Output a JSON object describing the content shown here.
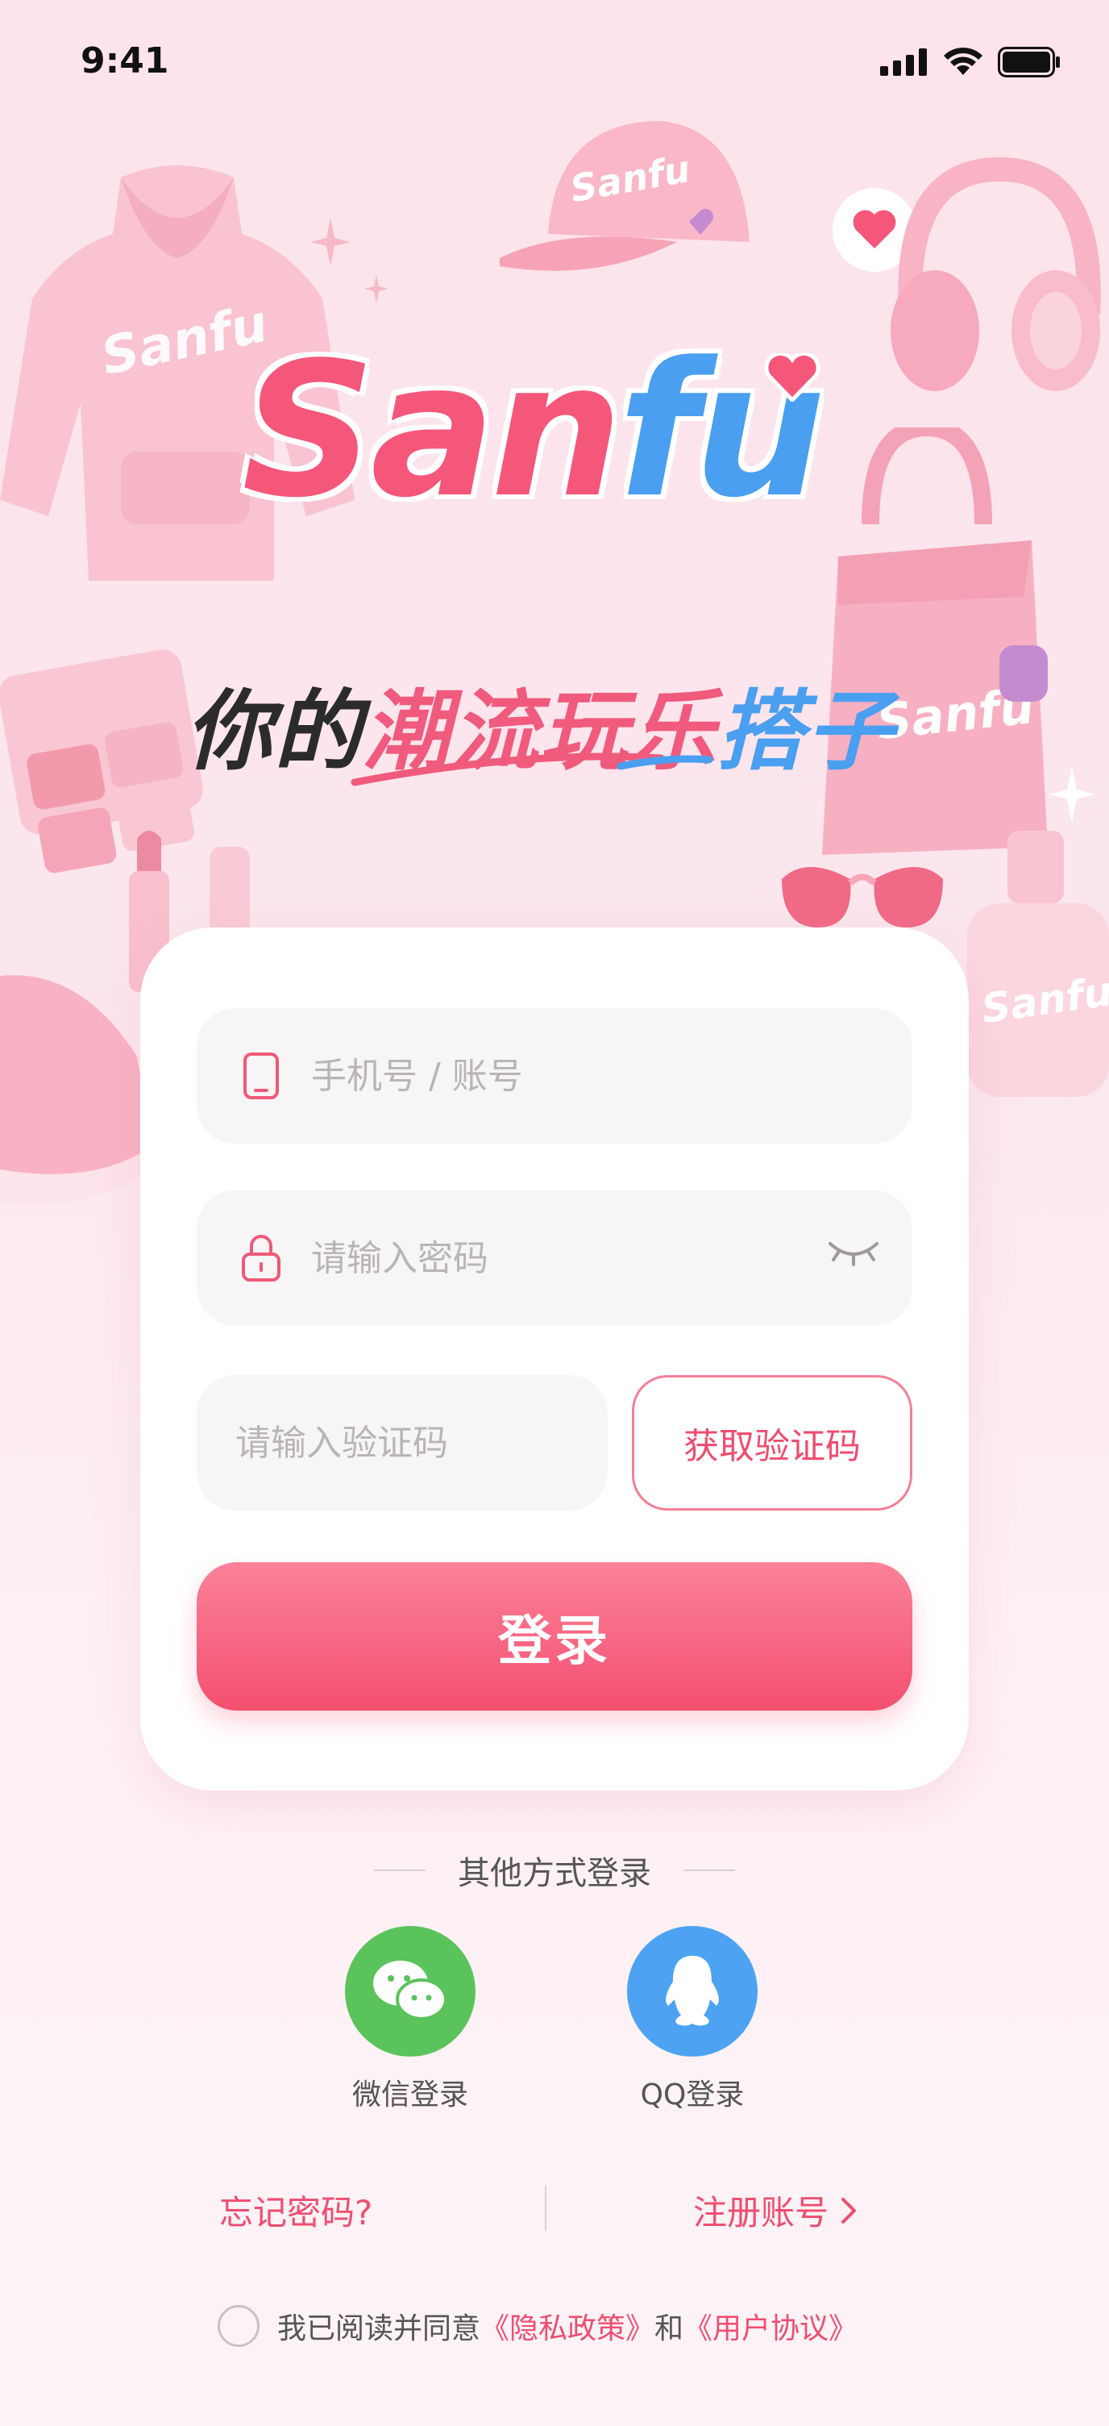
{
  "status_bar": {
    "time": "9:41"
  },
  "brand": {
    "logo_part1": "San",
    "logo_part2": "fu",
    "tagline_a": "你的",
    "tagline_b": "潮流玩乐",
    "tagline_c": "搭子"
  },
  "form": {
    "account_placeholder": "手机号 / 账号",
    "password_placeholder": "请输入密码",
    "code_placeholder": "请输入验证码",
    "get_code_label": "获取验证码",
    "login_label": "登录"
  },
  "other_login": {
    "title": "其他方式登录",
    "wechat_label": "微信登录",
    "qq_label": "QQ登录"
  },
  "links": {
    "forgot": "忘记密码?",
    "register": "注册账号"
  },
  "agreement": {
    "prefix": "我已阅读并同意",
    "privacy": "《隐私政策》",
    "and": "和",
    "terms": "《用户协议》"
  },
  "decor": {
    "brand_mark": "Sanfu"
  },
  "colors": {
    "accent": "#ef4d70",
    "logo_pink": "#f5577a",
    "logo_blue": "#4a9ff0",
    "wechat": "#5bc35b",
    "qq": "#4da3f1"
  }
}
